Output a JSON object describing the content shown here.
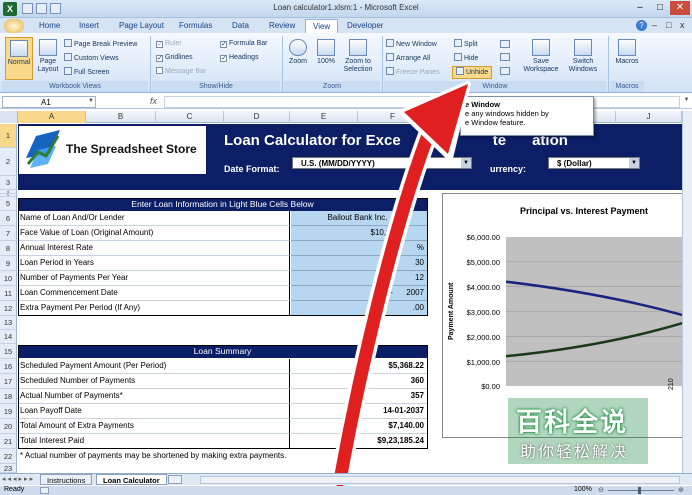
{
  "window": {
    "title": "Loan calculator1.xlsm:1 - Microsoft Excel"
  },
  "tabs": [
    "Home",
    "Insert",
    "Page Layout",
    "Formulas",
    "Data",
    "Review",
    "View",
    "Developer"
  ],
  "ribbon": {
    "workbook_views": {
      "label": "Workbook Views",
      "normal": "Normal",
      "page_layout": "Page Layout",
      "page_break_preview": "Page Break Preview",
      "custom_views": "Custom Views",
      "full_screen": "Full Screen"
    },
    "show_hide": {
      "label": "Show/Hide",
      "ruler": "Ruler",
      "gridlines": "Gridlines",
      "message_bar": "Message Bar",
      "formula_bar": "Formula Bar",
      "headings": "Headings"
    },
    "zoom": {
      "label": "Zoom",
      "zoom": "Zoom",
      "hundred": "100%",
      "zoom_to_selection": "Zoom to Selection"
    },
    "window": {
      "label": "Window",
      "new_window": "New Window",
      "arrange_all": "Arrange All",
      "freeze_panes": "Freeze Panes",
      "split": "Split",
      "hide": "Hide",
      "unhide": "Unhide",
      "save_workspace": "Save Workspace",
      "switch_windows": "Switch Windows"
    },
    "macros": {
      "label": "Macros",
      "macros": "Macros"
    }
  },
  "tooltip": {
    "title": "e Window",
    "line1": "e any windows hidden by",
    "line2": "e Window feature."
  },
  "formula_bar": {
    "name_box": "A1",
    "fx": "fx"
  },
  "columns": [
    "A",
    "B",
    "C",
    "D",
    "E",
    "F",
    "G",
    "H",
    "I",
    "J"
  ],
  "rows": [
    "1",
    "2",
    "3",
    "4",
    "5",
    "6",
    "7",
    "8",
    "9",
    "10",
    "11",
    "12",
    "13",
    "14",
    "15",
    "16",
    "17",
    "18",
    "19",
    "20",
    "21",
    "22",
    "23"
  ],
  "sheet": {
    "logo_text": "The Spreadsheet Store",
    "title": "Loan Calculator for Exce",
    "title_tail": "te",
    "title_tail2": "ation",
    "date_format_label": "Date Format:",
    "date_format_value": "U.S. (MM/DD/YYYY)",
    "currency_label": "urrency:",
    "currency_value": "$ (Dollar)",
    "input_header": "Enter Loan Information in Light Blue Cells Below",
    "inputs": [
      {
        "label": "Name of Loan And/Or Lender",
        "value": "Bailout Bank Inc."
      },
      {
        "label": "Face Value of Loan (Original Amount)",
        "value": "$10,00"
      },
      {
        "label": "Annual Interest Rate",
        "value": "%"
      },
      {
        "label": "Loan Period in Years",
        "value": "30"
      },
      {
        "label": "Number of Payments Per Year",
        "value": "12"
      },
      {
        "label": "Loan Commencement Date",
        "value": "14-      2007"
      },
      {
        "label": "Extra Payment Per Period (If Any)",
        "value": ".00"
      }
    ],
    "summary_header": "Loan Summary",
    "summary": [
      {
        "label": "Scheduled Payment Amount (Per Period)",
        "value": "$5,368.22"
      },
      {
        "label": "Scheduled Number of Payments",
        "value": "360"
      },
      {
        "label": "Actual Number of Payments*",
        "value": "357"
      },
      {
        "label": "Loan Payoff Date",
        "value": "14-01-2037"
      },
      {
        "label": "Total Amount of Extra Payments",
        "value": "$7,140.00"
      },
      {
        "label": "Total Interest Paid",
        "value": "$9,23,185.24"
      }
    ],
    "footnote": "* Actual number of payments may be shortened by making extra payments."
  },
  "chart_data": {
    "type": "line",
    "title": "Principal vs. Interest Payment",
    "ylabel": "Payment Amount",
    "yticks": [
      "$6,000.00",
      "$5,000.00",
      "$4,000.00",
      "$3,000.00",
      "$2,000.00",
      "$1,000.00",
      "$0.00"
    ],
    "ylim": [
      0,
      6000
    ],
    "x": [
      0,
      1
    ],
    "series": [
      {
        "color": "#1a237e",
        "values": [
          4200,
          2750
        ]
      },
      {
        "color": "#1b3a1b",
        "values": [
          1200,
          2650
        ]
      }
    ],
    "x_tick_fragment": "210"
  },
  "sheet_tabs": [
    "Instructions",
    "Loan Calculator"
  ],
  "status": {
    "ready": "Ready",
    "zoom": "100%"
  },
  "watermark": {
    "line1": "百科全说",
    "line2": "助你轻松解决"
  },
  "colors": {
    "navy": "#0b1e66",
    "input_blue": "#b7d6ef",
    "arrow_red": "#e02020"
  }
}
